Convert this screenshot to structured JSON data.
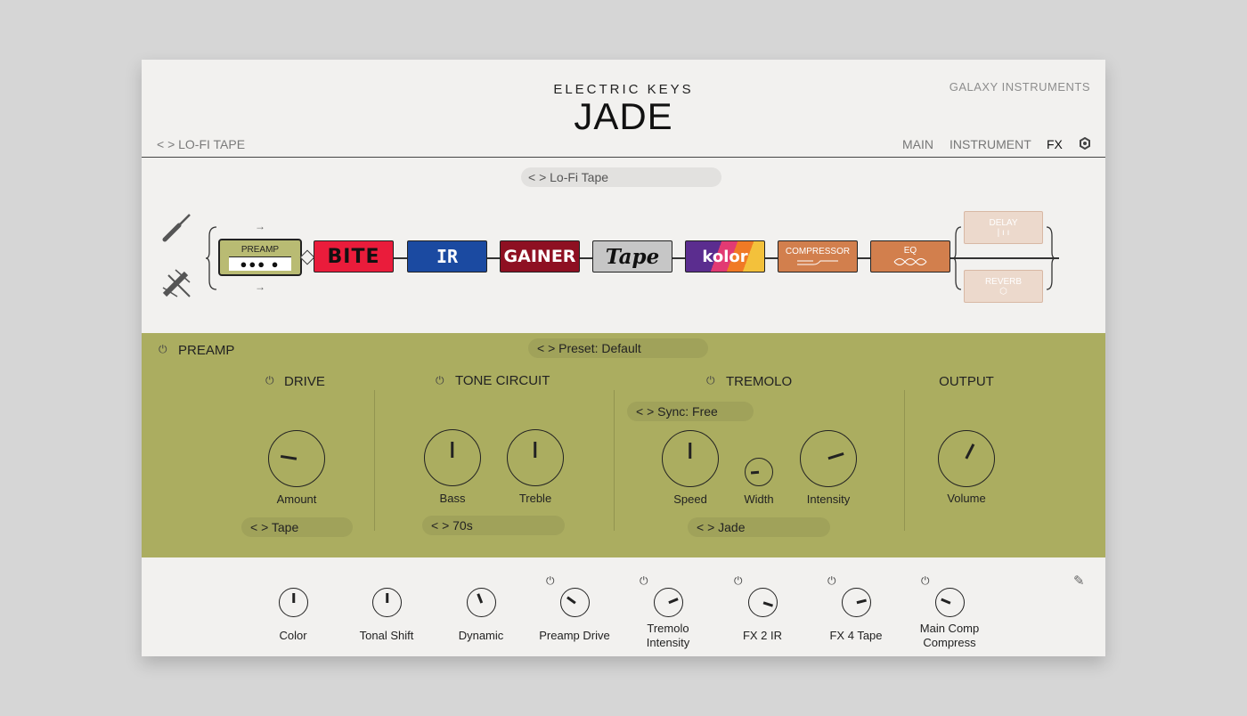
{
  "header": {
    "subtitle": "ELECTRIC KEYS",
    "title": "JADE",
    "brand": "GALAXY INSTRUMENTS",
    "preset_nav": "< > LO-FI TAPE",
    "nav": [
      "MAIN",
      "INSTRUMENT",
      "FX"
    ],
    "active_tab": "FX",
    "settings_icon": "gear-icon"
  },
  "fx_chain": {
    "preset_label": "< > Lo-Fi Tape",
    "preamp_label": "PREAMP",
    "modules": [
      "BITE",
      "IR",
      "GAINER",
      "Tape",
      "kolor",
      "COMPRESSOR",
      "EQ"
    ],
    "parallel": [
      "DELAY",
      "REVERB"
    ],
    "input_icons": [
      "guitar-cable-icon",
      "cable-bypass-icon"
    ]
  },
  "preamp": {
    "title": "PREAMP",
    "preset": "< > Preset: Default",
    "drive": {
      "title": "DRIVE",
      "knob_label": "Amount",
      "knob_value": 0.2,
      "selector": "< > Tape"
    },
    "tone": {
      "title": "TONE CIRCUIT",
      "bass_label": "Bass",
      "bass_value": 0.5,
      "treble_label": "Treble",
      "treble_value": 0.5,
      "selector": "< > 70s"
    },
    "tremolo": {
      "title": "TREMOLO",
      "sync": "< > Sync: Free",
      "speed_label": "Speed",
      "speed_value": 0.5,
      "width_label": "Width",
      "width_value": 0.15,
      "intensity_label": "Intensity",
      "intensity_value": 0.77,
      "selector": "< > Jade"
    },
    "output": {
      "title": "OUTPUT",
      "volume_label": "Volume",
      "volume_value": 0.6
    }
  },
  "macros": [
    {
      "label": "Color",
      "value": 0.5,
      "power": false
    },
    {
      "label": "Tonal Shift",
      "value": 0.5,
      "power": false
    },
    {
      "label": "Dynamic",
      "value": 0.42,
      "power": false
    },
    {
      "label": "Preamp Drive",
      "value": 0.3,
      "power": true
    },
    {
      "label": "Tremolo Intensity",
      "value": 0.75,
      "power": true
    },
    {
      "label": "FX 2 IR",
      "value": 0.9,
      "power": true
    },
    {
      "label": "FX 4 Tape",
      "value": 0.78,
      "power": true
    },
    {
      "label": "Main Comp Compress",
      "value": 0.25,
      "power": true
    }
  ],
  "colors": {
    "panel_green": "#abad60",
    "background": "#f2f1ef",
    "bite": "#ea1c3b",
    "ir": "#1b4aa1",
    "gainer": "#8e1022",
    "orange_module": "#d27f4d"
  }
}
